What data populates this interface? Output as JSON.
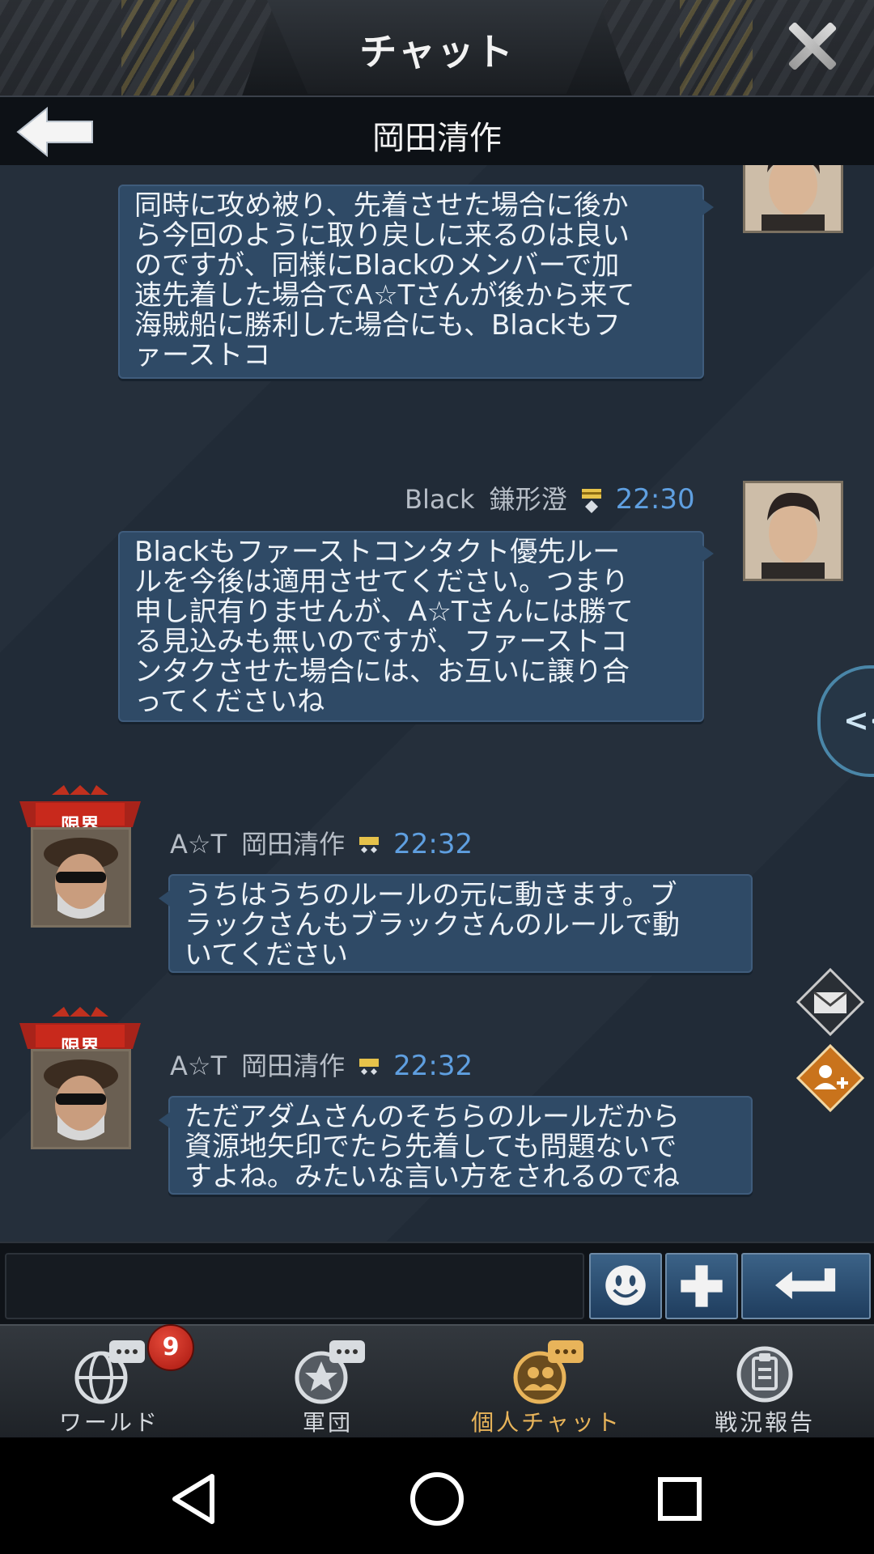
{
  "header": {
    "title": "チャット",
    "close_icon": "close-icon"
  },
  "subheader": {
    "title": "岡田清作",
    "back_icon": "back-arrow-icon"
  },
  "messages": [
    {
      "side": "right",
      "text": "同時に攻め被り、先着させた場合に後か\nら今回のように取り戻しに来るのは良い\nのですが、同様にBlackのメンバーで加\n速先着した場合でA☆Tさんが後から来て\n海賊船に勝利した場合にも、Blackもフ\nァーストコ"
    },
    {
      "side": "right",
      "alliance": "Black",
      "name": "鎌形澄",
      "time": "22:30",
      "text": "Blackもファーストコンタクト優先ルー\nルを今後は適用させてください。つまり\n申し訳有りませんが、A☆Tさんには勝て\nる見込みも無いのですが、ファーストコ\nンタクさせた場合には、お互いに譲り合\nってくださいね"
    },
    {
      "side": "left",
      "badge": "限界",
      "alliance": "A☆T",
      "name": "岡田清作",
      "time": "22:32",
      "text": "うちはうちのルールの元に動きます。ブ\nラックさんもブラックさんのルールで動\nいてください"
    },
    {
      "side": "left",
      "badge": "限界",
      "alliance": "A☆T",
      "name": "岡田清作",
      "time": "22:32",
      "text": "ただアダムさんのそちらのルールだから\n資源地矢印でたら先着しても問題ないで\nすよね。みたいな言い方をされるのでね"
    }
  ],
  "side_controls": {
    "collapse_label": "<<",
    "mail_icon": "mail-icon",
    "add_friend_icon": "add-friend-icon"
  },
  "input": {
    "value": "",
    "emoji_icon": "smiley-icon",
    "plus_icon": "plus-icon",
    "send_icon": "enter-icon"
  },
  "nav": [
    {
      "label": "ワールド",
      "icon": "globe-chat-icon",
      "badge": "9"
    },
    {
      "label": "軍団",
      "icon": "star-chat-icon"
    },
    {
      "label": "個人チャット",
      "icon": "people-chat-icon",
      "active": true
    },
    {
      "label": "戦況報告",
      "icon": "report-icon"
    }
  ],
  "colors": {
    "bubble": "#2f4a66",
    "time": "#5f9fe0",
    "active_tab": "#e8b45a",
    "badge": "#d63426"
  }
}
